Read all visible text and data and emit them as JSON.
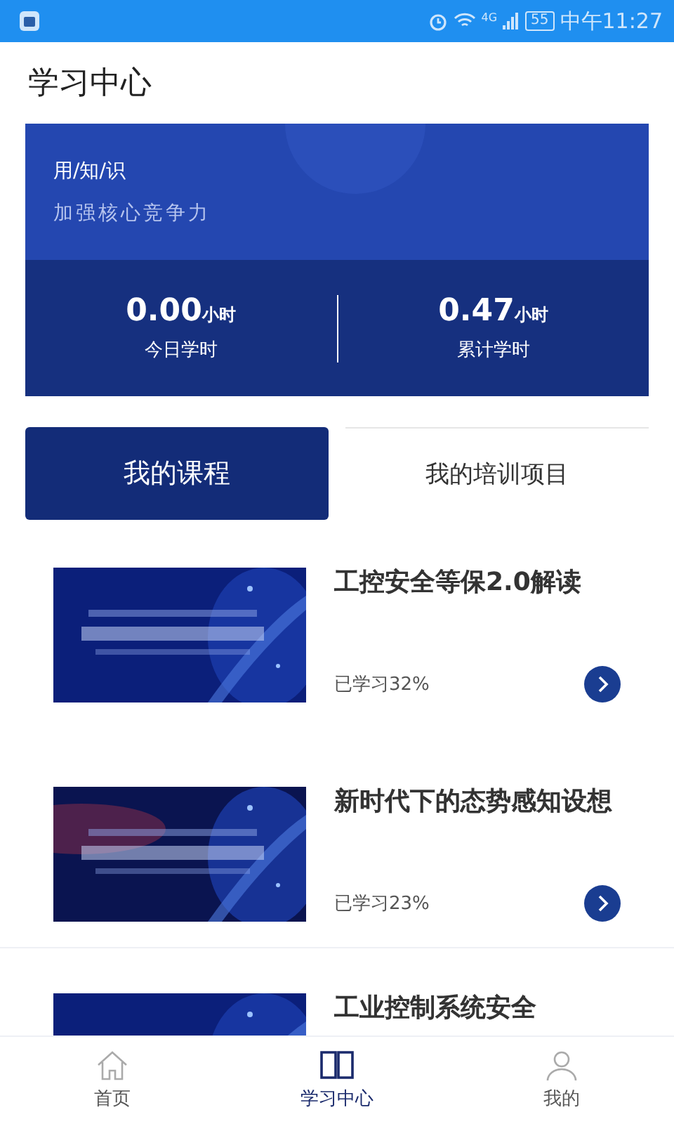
{
  "status_bar": {
    "network": "4G",
    "battery": "55",
    "time": "中午11:27"
  },
  "header": {
    "title": "学习中心"
  },
  "banner": {
    "tagline": "用/知/识",
    "slogan": "加强核心竞争力",
    "stats": [
      {
        "value": "0.00",
        "unit": "小时",
        "label": "今日学时"
      },
      {
        "value": "0.47",
        "unit": "小时",
        "label": "累计学时"
      }
    ]
  },
  "tabs": [
    {
      "label": "我的课程",
      "selected": true
    },
    {
      "label": "我的培训项目",
      "selected": false
    }
  ],
  "courses": [
    {
      "title": "工控安全等保2.0解读",
      "progress": "已学习32%"
    },
    {
      "title": "新时代下的态势感知设想",
      "progress": "已学习23%"
    },
    {
      "title": "工业控制系统安全"
    }
  ],
  "bottom_nav": [
    {
      "label": "首页",
      "selected": false
    },
    {
      "label": "学习中心",
      "selected": true
    },
    {
      "label": "我的",
      "selected": false
    }
  ]
}
